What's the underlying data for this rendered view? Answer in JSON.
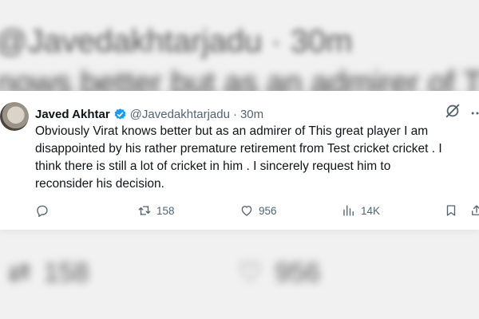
{
  "background": {
    "handle_line": "@Javedakhtarjadu · 30m",
    "text_line": "nows better but as an admirer of Th",
    "retweet_count": "158",
    "like_count": "956"
  },
  "tweet": {
    "author_name": "Javed Akhtar",
    "handle": "@Javedakhtarjadu",
    "separator": "·",
    "time": "30m",
    "text_lines": [
      "Obviously Virat knows better but as an admirer of This great player I am",
      "disappointed by his rather premature retirement from Test cricket cricket . I",
      "think there is still a lot of cricket in him . I sincerely request him to",
      "reconsider his decision."
    ],
    "actions": {
      "retweets": "158",
      "likes": "956",
      "views": "14K"
    }
  },
  "colors": {
    "text": "#0f1419",
    "muted": "#536471",
    "verified": "#1d9bf0"
  }
}
